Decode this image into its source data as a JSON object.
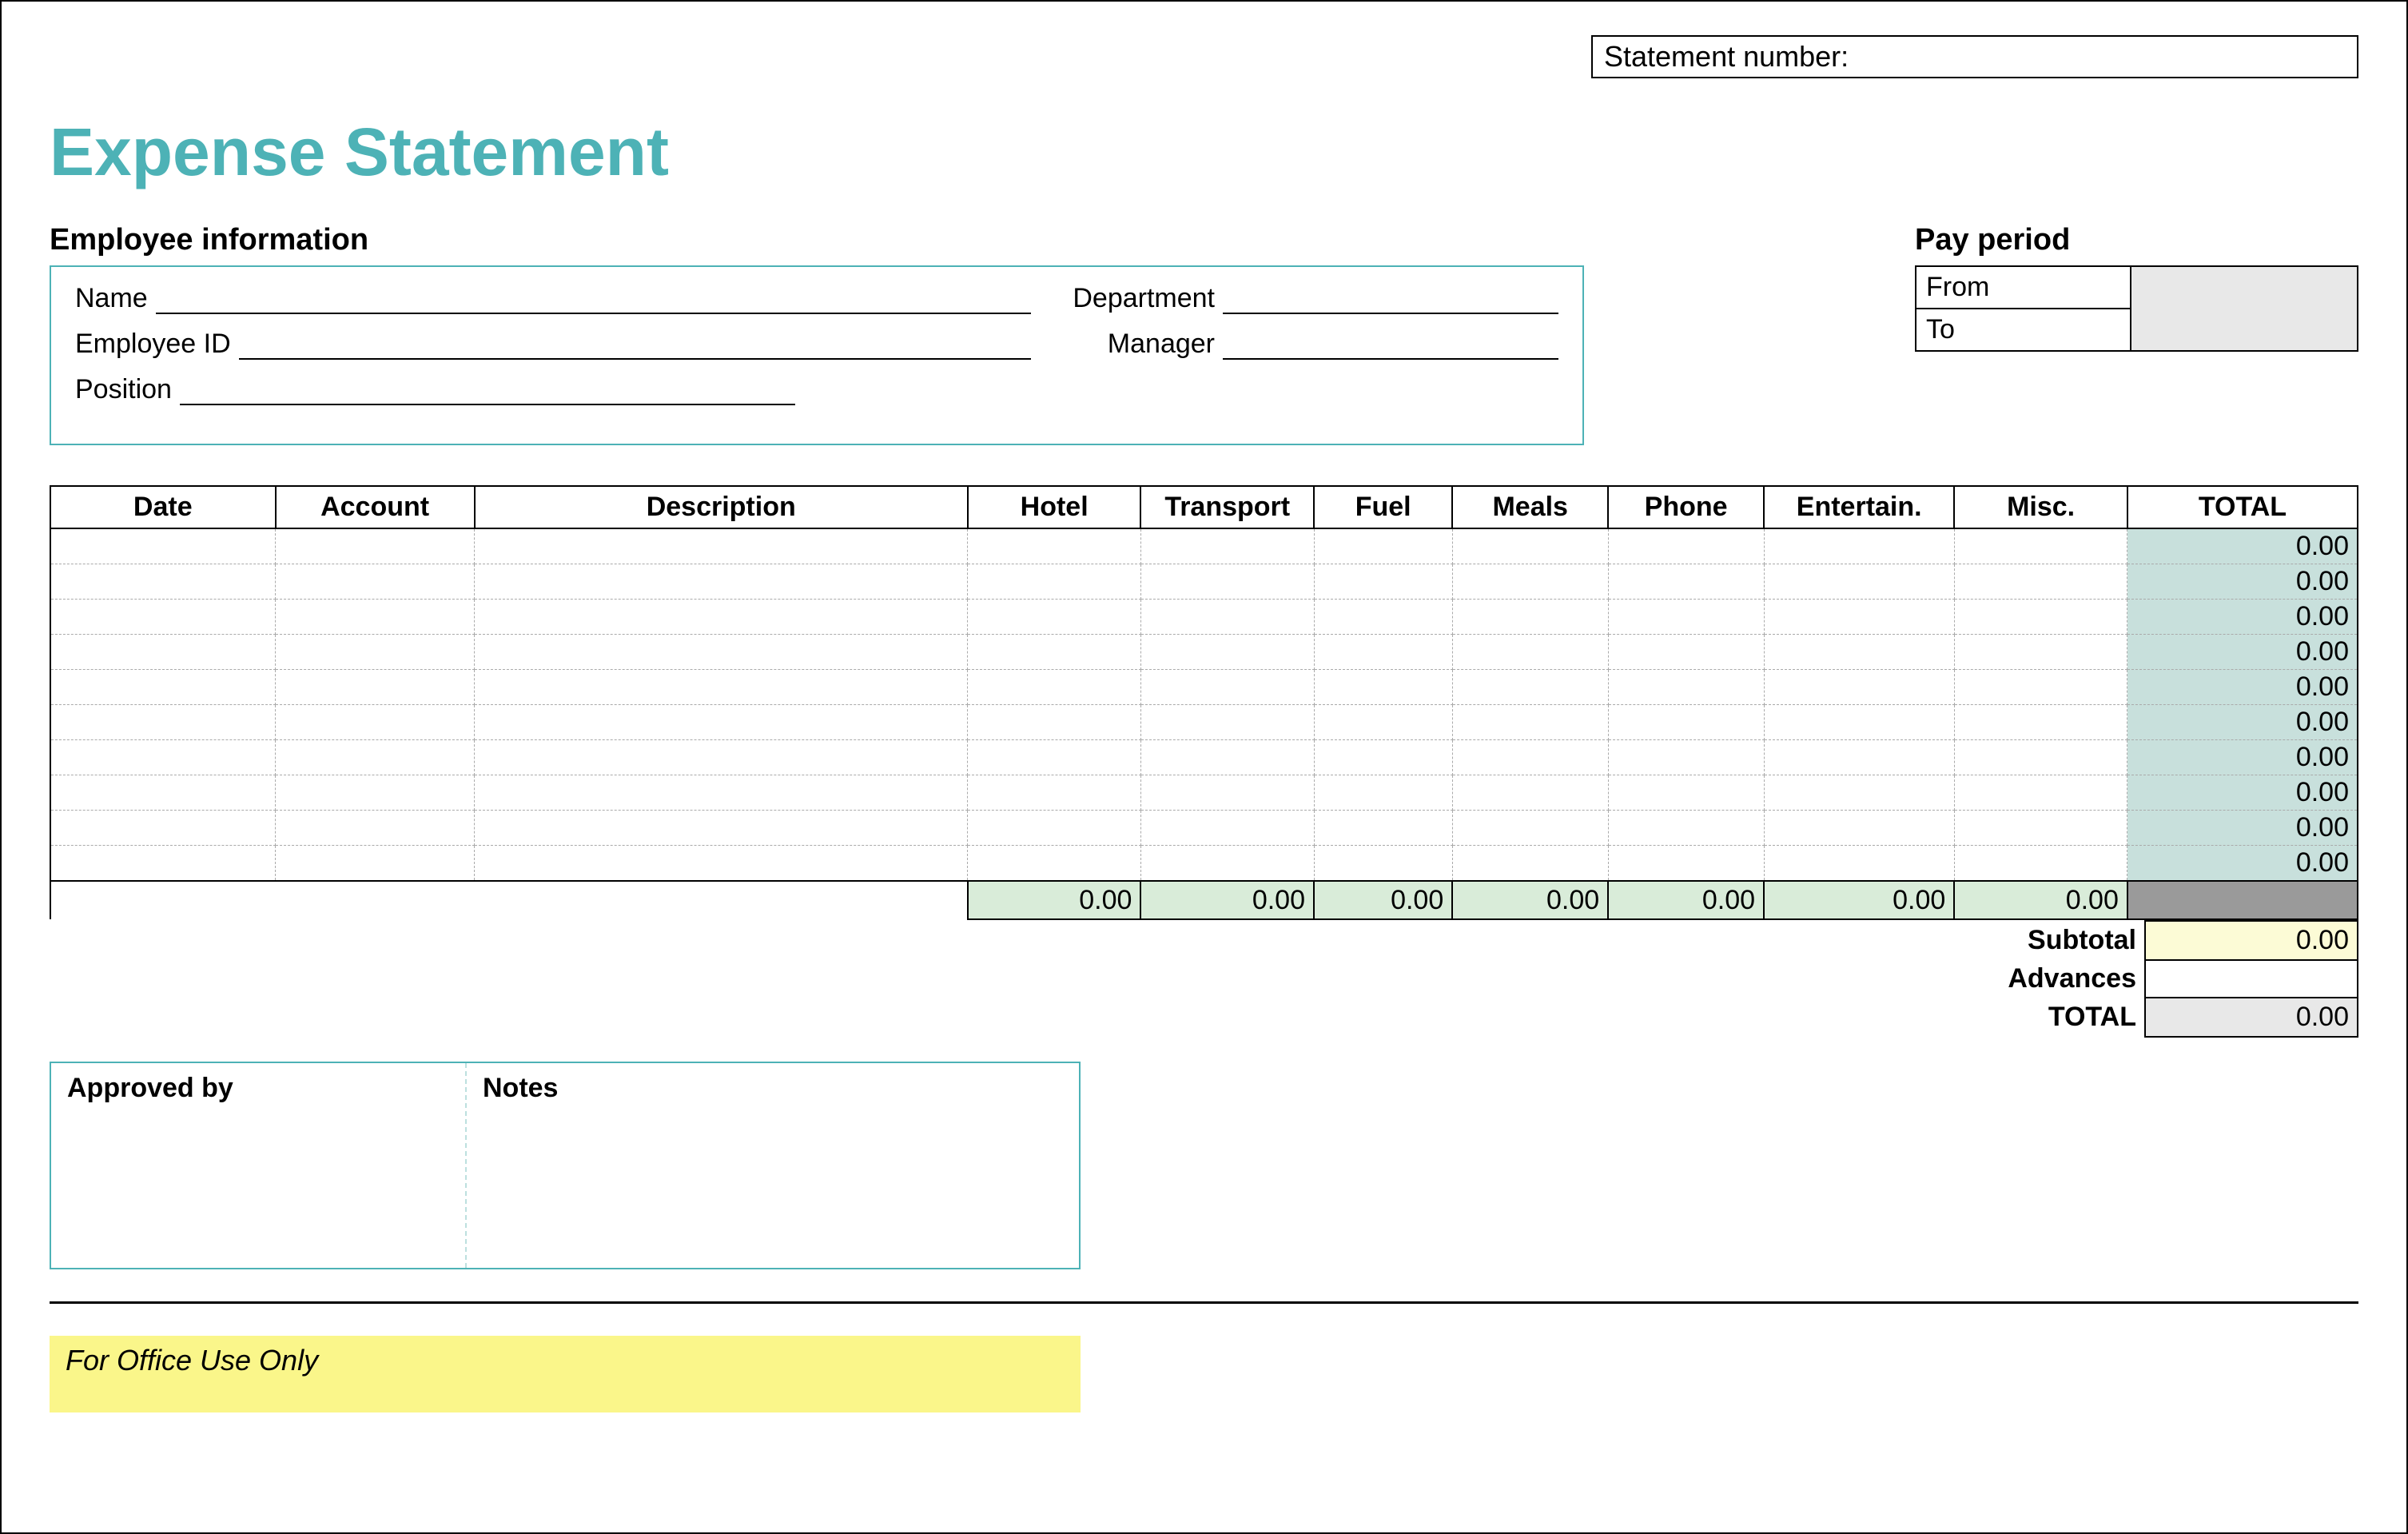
{
  "statement_number_label": "Statement number:",
  "statement_number_value": "",
  "title": "Expense Statement",
  "employee_info_heading": "Employee information",
  "employee": {
    "name_label": "Name",
    "name_value": "",
    "employee_id_label": "Employee ID",
    "employee_id_value": "",
    "position_label": "Position",
    "position_value": "",
    "department_label": "Department",
    "department_value": "",
    "manager_label": "Manager",
    "manager_value": ""
  },
  "pay_period_heading": "Pay period",
  "pay_period": {
    "from_label": "From",
    "from_value": "",
    "to_label": "To",
    "to_value": ""
  },
  "expense_columns": {
    "date": "Date",
    "account": "Account",
    "description": "Description",
    "hotel": "Hotel",
    "transport": "Transport",
    "fuel": "Fuel",
    "meals": "Meals",
    "phone": "Phone",
    "entertain": "Entertain.",
    "misc": "Misc.",
    "total": "TOTAL"
  },
  "expense_rows": [
    {
      "date": "",
      "account": "",
      "description": "",
      "hotel": "",
      "transport": "",
      "fuel": "",
      "meals": "",
      "phone": "",
      "entertain": "",
      "misc": "",
      "total": "0.00"
    },
    {
      "date": "",
      "account": "",
      "description": "",
      "hotel": "",
      "transport": "",
      "fuel": "",
      "meals": "",
      "phone": "",
      "entertain": "",
      "misc": "",
      "total": "0.00"
    },
    {
      "date": "",
      "account": "",
      "description": "",
      "hotel": "",
      "transport": "",
      "fuel": "",
      "meals": "",
      "phone": "",
      "entertain": "",
      "misc": "",
      "total": "0.00"
    },
    {
      "date": "",
      "account": "",
      "description": "",
      "hotel": "",
      "transport": "",
      "fuel": "",
      "meals": "",
      "phone": "",
      "entertain": "",
      "misc": "",
      "total": "0.00"
    },
    {
      "date": "",
      "account": "",
      "description": "",
      "hotel": "",
      "transport": "",
      "fuel": "",
      "meals": "",
      "phone": "",
      "entertain": "",
      "misc": "",
      "total": "0.00"
    },
    {
      "date": "",
      "account": "",
      "description": "",
      "hotel": "",
      "transport": "",
      "fuel": "",
      "meals": "",
      "phone": "",
      "entertain": "",
      "misc": "",
      "total": "0.00"
    },
    {
      "date": "",
      "account": "",
      "description": "",
      "hotel": "",
      "transport": "",
      "fuel": "",
      "meals": "",
      "phone": "",
      "entertain": "",
      "misc": "",
      "total": "0.00"
    },
    {
      "date": "",
      "account": "",
      "description": "",
      "hotel": "",
      "transport": "",
      "fuel": "",
      "meals": "",
      "phone": "",
      "entertain": "",
      "misc": "",
      "total": "0.00"
    },
    {
      "date": "",
      "account": "",
      "description": "",
      "hotel": "",
      "transport": "",
      "fuel": "",
      "meals": "",
      "phone": "",
      "entertain": "",
      "misc": "",
      "total": "0.00"
    },
    {
      "date": "",
      "account": "",
      "description": "",
      "hotel": "",
      "transport": "",
      "fuel": "",
      "meals": "",
      "phone": "",
      "entertain": "",
      "misc": "",
      "total": "0.00"
    }
  ],
  "column_sums": {
    "hotel": "0.00",
    "transport": "0.00",
    "fuel": "0.00",
    "meals": "0.00",
    "phone": "0.00",
    "entertain": "0.00",
    "misc": "0.00",
    "total": ""
  },
  "summary": {
    "subtotal_label": "Subtotal",
    "subtotal_value": "0.00",
    "advances_label": "Advances",
    "advances_value": "",
    "total_label": "TOTAL",
    "total_value": "0.00"
  },
  "approved_by_label": "Approved by",
  "notes_label": "Notes",
  "office_use_only": "For Office Use Only"
}
